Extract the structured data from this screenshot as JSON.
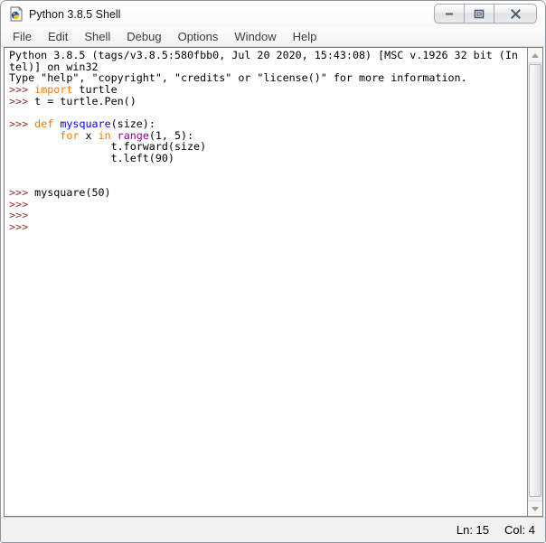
{
  "window": {
    "title": "Python 3.8.5 Shell"
  },
  "menu": {
    "items": [
      "File",
      "Edit",
      "Shell",
      "Debug",
      "Options",
      "Window",
      "Help"
    ]
  },
  "shell": {
    "lines": [
      [
        [
          "n",
          "Python 3.8.5 (tags/v3.8.5:580fbb0, Jul 20 2020, 15:43:08) [MSC v.1926 32 bit (In"
        ]
      ],
      [
        [
          "n",
          "tel)] on win32"
        ]
      ],
      [
        [
          "n",
          "Type \"help\", \"copyright\", \"credits\" or \"license()\" for more information."
        ]
      ],
      [
        [
          "p",
          ">>> "
        ],
        [
          "k",
          "import"
        ],
        [
          "n",
          " turtle"
        ]
      ],
      [
        [
          "p",
          ">>> "
        ],
        [
          "n",
          "t = turtle.Pen()"
        ]
      ],
      [],
      [
        [
          "p",
          ">>> "
        ],
        [
          "k",
          "def"
        ],
        [
          "n",
          " "
        ],
        [
          "d",
          "mysquare"
        ],
        [
          "n",
          "(size):"
        ]
      ],
      [
        [
          "n",
          "        "
        ],
        [
          "k",
          "for"
        ],
        [
          "n",
          " x "
        ],
        [
          "k",
          "in"
        ],
        [
          "n",
          " "
        ],
        [
          "b",
          "range"
        ],
        [
          "n",
          "(1, 5):"
        ]
      ],
      [
        [
          "n",
          "                t.forward(size)"
        ]
      ],
      [
        [
          "n",
          "                t.left(90)"
        ]
      ],
      [],
      [],
      [
        [
          "p",
          ">>> "
        ],
        [
          "n",
          "mysquare(50)"
        ]
      ],
      [
        [
          "p",
          ">>>"
        ]
      ],
      [
        [
          "p",
          ">>>"
        ]
      ],
      [
        [
          "p",
          ">>>"
        ]
      ]
    ]
  },
  "status": {
    "ln": "Ln: 15",
    "col": "Col: 4"
  },
  "icons": {
    "app": "idle-python-icon",
    "minimize": "minimize-icon",
    "maximize": "maximize-icon",
    "close": "close-icon",
    "scroll_up": "scroll-up-arrow-icon",
    "scroll_down": "scroll-down-arrow-icon"
  },
  "colors": {
    "prompt": "#993333",
    "keyword": "#ff7700",
    "definition": "#0000ff",
    "builtin": "#900090",
    "text": "#000000",
    "menu-text": "#3a3a3a",
    "glyph": "#4e5872"
  }
}
